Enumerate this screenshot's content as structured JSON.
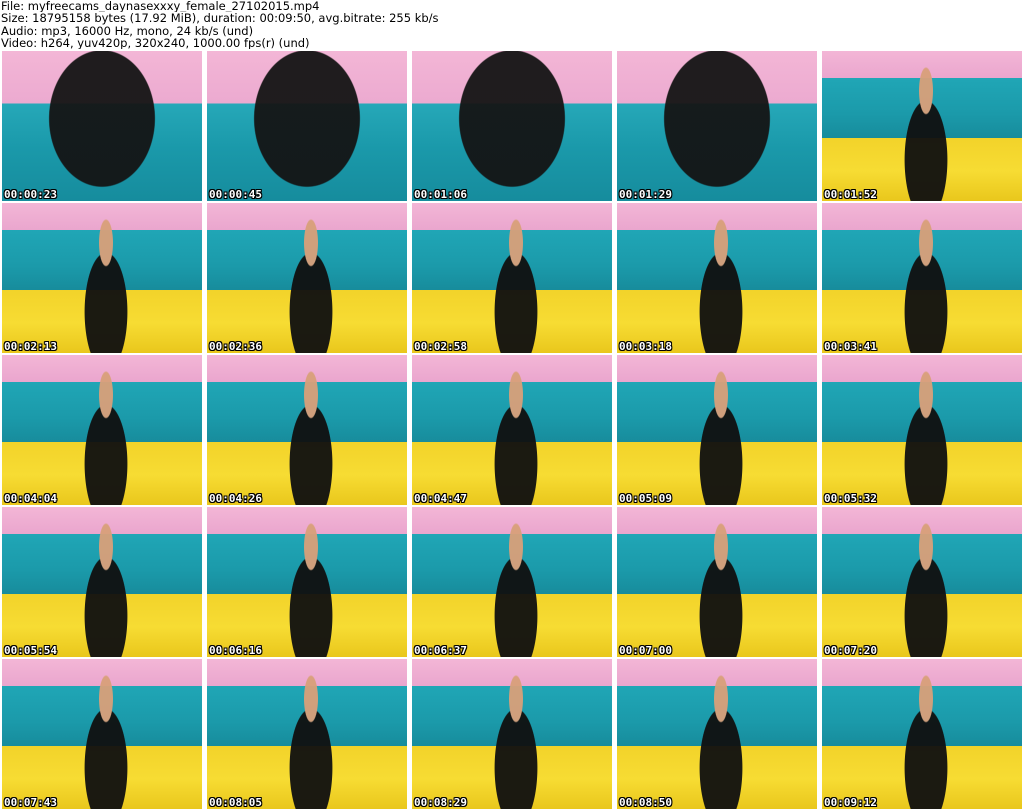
{
  "header": {
    "lines": [
      "File: myfreecams_daynasexxxy_female_27102015.mp4",
      "Size: 18795158 bytes (17.92 MiB), duration: 00:09:50, avg.bitrate: 255 kb/s",
      "Audio: mp3, 16000 Hz, mono, 24 kb/s (und)",
      "Video: h264, yuv420p, 320x240, 1000.00 fps(r) (und)"
    ]
  },
  "thumbnails": [
    {
      "timestamp": "00:00:23"
    },
    {
      "timestamp": "00:00:45"
    },
    {
      "timestamp": "00:01:06"
    },
    {
      "timestamp": "00:01:29"
    },
    {
      "timestamp": "00:01:52"
    },
    {
      "timestamp": "00:02:13"
    },
    {
      "timestamp": "00:02:36"
    },
    {
      "timestamp": "00:02:58"
    },
    {
      "timestamp": "00:03:18"
    },
    {
      "timestamp": "00:03:41"
    },
    {
      "timestamp": "00:04:04"
    },
    {
      "timestamp": "00:04:26"
    },
    {
      "timestamp": "00:04:47"
    },
    {
      "timestamp": "00:05:09"
    },
    {
      "timestamp": "00:05:32"
    },
    {
      "timestamp": "00:05:54"
    },
    {
      "timestamp": "00:06:16"
    },
    {
      "timestamp": "00:06:37"
    },
    {
      "timestamp": "00:07:00"
    },
    {
      "timestamp": "00:07:20"
    },
    {
      "timestamp": "00:07:43"
    },
    {
      "timestamp": "00:08:05"
    },
    {
      "timestamp": "00:08:29"
    },
    {
      "timestamp": "00:08:50"
    },
    {
      "timestamp": "00:09:12"
    }
  ],
  "colors": {
    "pink_backdrop": "#f3b6d6",
    "teal_headboard": "#20a6b6",
    "yellow_blanket": "#f2d32a",
    "timestamp_text": "#ffffff",
    "timestamp_outline": "#000000"
  }
}
